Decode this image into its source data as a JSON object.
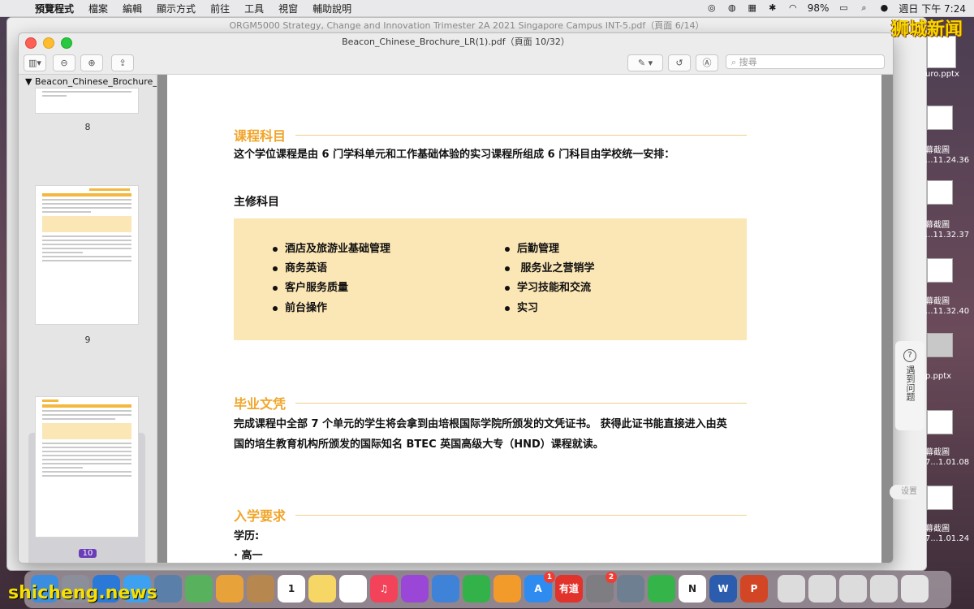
{
  "menubar": {
    "app": "預覽程式",
    "items": [
      "檔案",
      "編輯",
      "顯示方式",
      "前往",
      "工具",
      "視窗",
      "輔助說明"
    ],
    "battery": "98%",
    "clock": "週日 下午 7:24"
  },
  "watermark_top": "狮城新闻",
  "watermark_bottom": "shicheng.news",
  "background_window": {
    "title": "ORGM5000 Strategy, Change and Innovation Trimester 2A 2021 Singapore Campus INT-5.pdf（頁面 6/14）"
  },
  "window": {
    "title": "Beacon_Chinese_Brochure_LR(1).pdf（頁面 10/32）",
    "search_placeholder": "搜尋"
  },
  "sidebar": {
    "header": "Beacon_Chinese_Brochure_LR...",
    "pages": [
      "8",
      "9",
      "10"
    ],
    "selected": "10"
  },
  "document": {
    "section1_title": "课程科目",
    "section1_text": "这个学位课程是由 6 门学科单元和工作基础体验的实习课程所组成 6 门科目由学校统一安排：",
    "major_title": "主修科目",
    "courses_left": [
      "酒店及旅游业基础管理",
      "商务英语",
      "客户服务质量",
      "前台操作"
    ],
    "courses_right": [
      "后勤管理",
      " 服务业之营销学",
      "学习技能和交流",
      "实习"
    ],
    "section2_title": "毕业文凭",
    "section2_line1": "完成课程中全部 7 个单元的学生将会拿到由培根国际学院所颁发的文凭证书。 获得此证书能直接进入由英",
    "section2_line2": "国的培生教育机构所颁发的国际知名 BTEC 英国高级大专（HND）课程就读。",
    "section3_title": "入学要求",
    "edu_label": "学历:",
    "edu_item": "高一"
  },
  "desktop": {
    "labels": [
      "uro.pptx",
      "幕截圖\n...11.24.36",
      "幕截圖\n...11.32.37",
      "幕截圖\n...11.32.40",
      "p.pptx",
      "幕截圖\n7...1.01.08",
      "幕截圖\n7...1.01.24"
    ]
  },
  "help_panel": {
    "label": "遇到问题",
    "settings": "设置"
  },
  "dock": {
    "items": [
      {
        "name": "finder",
        "label": "",
        "color": "#3b8de0"
      },
      {
        "name": "launchpad",
        "label": "",
        "color": "#8a8f9a"
      },
      {
        "name": "safari",
        "label": "",
        "color": "#2a79d9"
      },
      {
        "name": "mail",
        "label": "",
        "color": "#3ea0f0"
      },
      {
        "name": "preview",
        "label": "",
        "color": "#5a7fa8"
      },
      {
        "name": "maps",
        "label": "",
        "color": "#58b15c"
      },
      {
        "name": "photos",
        "label": "",
        "color": "#e8a23a"
      },
      {
        "name": "contacts",
        "label": "",
        "color": "#b6874e"
      },
      {
        "name": "calendar",
        "label": "1",
        "color": "#ffffff"
      },
      {
        "name": "notes",
        "label": "",
        "color": "#f6d664"
      },
      {
        "name": "reminders",
        "label": "",
        "color": "#ffffff"
      },
      {
        "name": "music",
        "label": "♫",
        "color": "#f2435a"
      },
      {
        "name": "podcasts",
        "label": "",
        "color": "#9a47d8"
      },
      {
        "name": "keynote",
        "label": "",
        "color": "#3f83d8"
      },
      {
        "name": "numbers",
        "label": "",
        "color": "#33b24a"
      },
      {
        "name": "pages",
        "label": "",
        "color": "#f29b2b"
      },
      {
        "name": "app-store",
        "label": "A",
        "color": "#2e8cf0",
        "badge": "1"
      },
      {
        "name": "youdao",
        "label": "有道",
        "color": "#e2322c"
      },
      {
        "name": "system-preferences",
        "label": "",
        "color": "#7d7d82",
        "badge": "2"
      },
      {
        "name": "screenshot",
        "label": "",
        "color": "#6e7f92"
      },
      {
        "name": "wechat",
        "label": "",
        "color": "#35b44a"
      },
      {
        "name": "notion",
        "label": "N",
        "color": "#ffffff"
      },
      {
        "name": "word",
        "label": "W",
        "color": "#2b5cad"
      },
      {
        "name": "powerpoint",
        "label": "P",
        "color": "#d24625"
      },
      {
        "name": "downloads",
        "label": "",
        "color": "#dcdcdc"
      },
      {
        "name": "documents",
        "label": "",
        "color": "#dcdcdc"
      },
      {
        "name": "desktop-stack",
        "label": "",
        "color": "#dcdcdc"
      },
      {
        "name": "recent",
        "label": "",
        "color": "#dcdcdc"
      },
      {
        "name": "trash",
        "label": "",
        "color": "#e5e5e5"
      }
    ]
  },
  "colors": {
    "accent": "#f0a52a",
    "panel": "#fbe6b5",
    "selection": "#6a3cb8"
  }
}
